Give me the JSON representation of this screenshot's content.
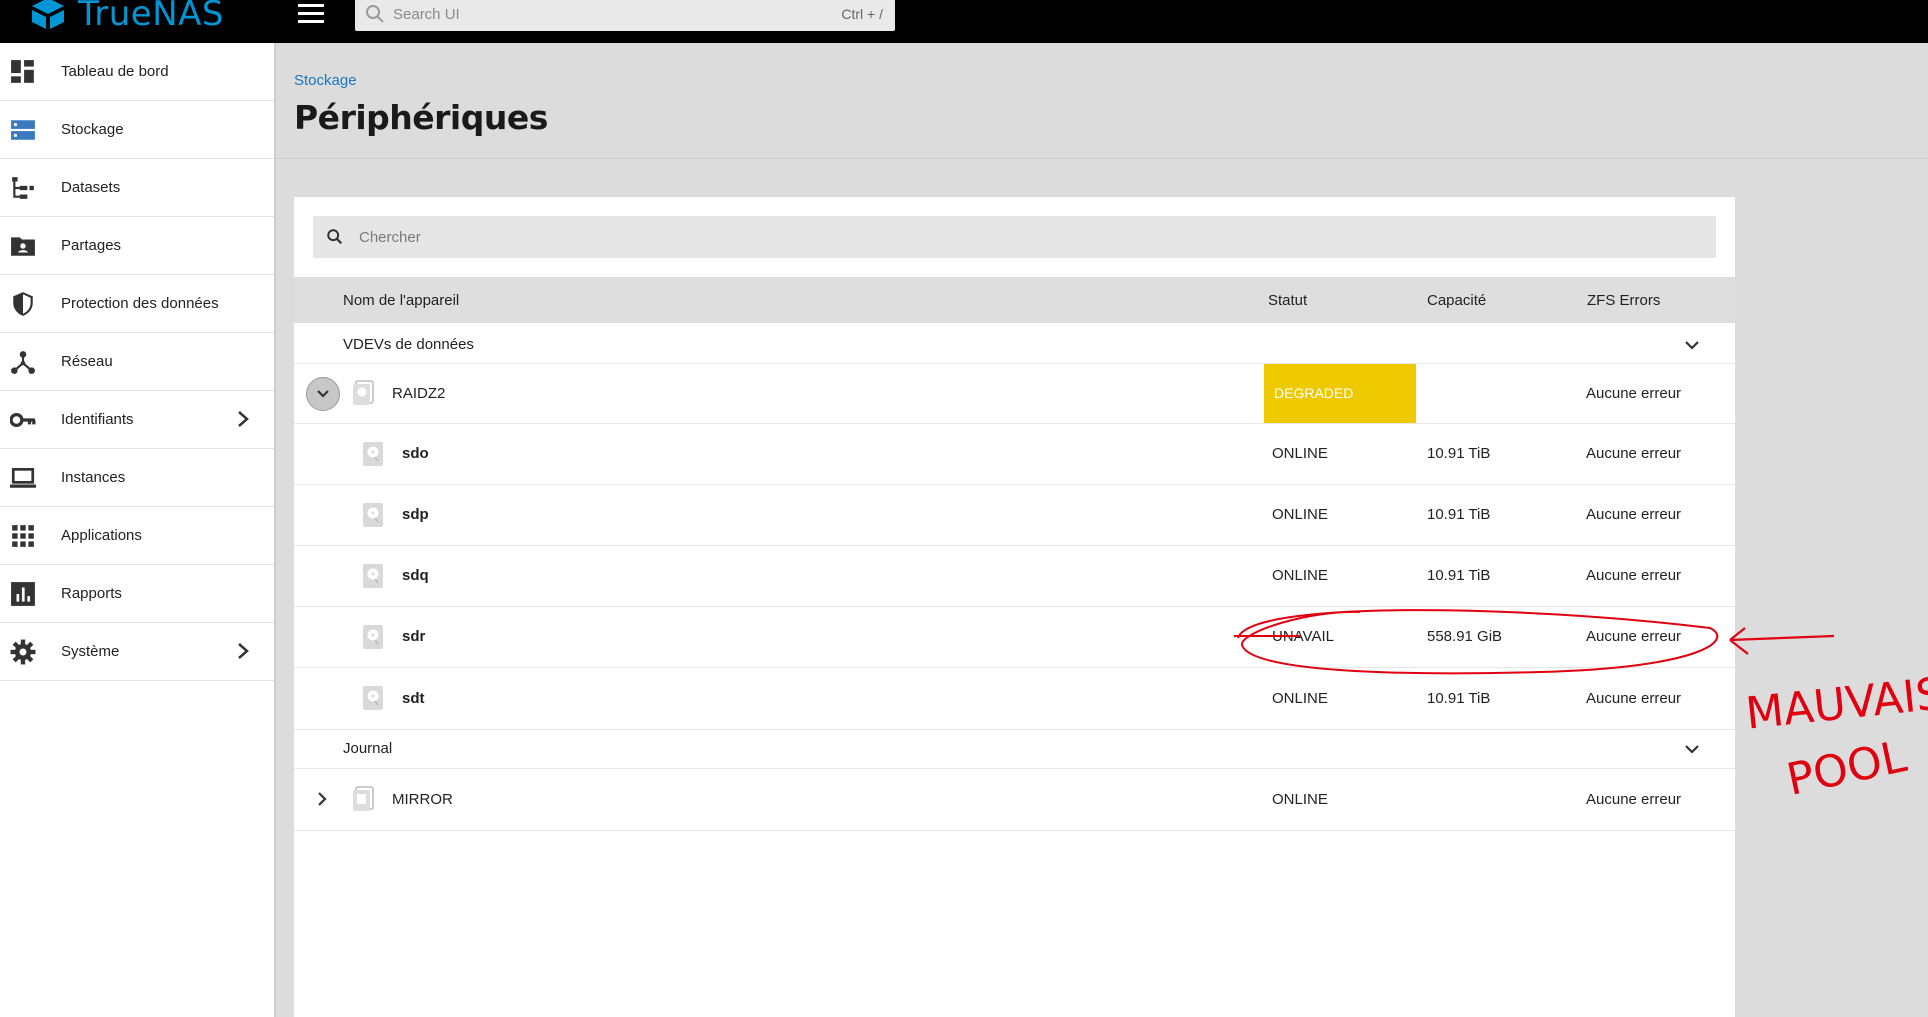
{
  "app": {
    "name": "TrueNAS"
  },
  "search": {
    "placeholder": "Search UI",
    "shortcut": "Ctrl + /"
  },
  "sidebar": {
    "items": [
      {
        "label": "Tableau de bord",
        "icon": "dashboard-icon"
      },
      {
        "label": "Stockage",
        "icon": "storage-icon"
      },
      {
        "label": "Datasets",
        "icon": "datasets-icon"
      },
      {
        "label": "Partages",
        "icon": "shares-icon"
      },
      {
        "label": "Protection des données",
        "icon": "shield-icon"
      },
      {
        "label": "Réseau",
        "icon": "network-icon"
      },
      {
        "label": "Identifiants",
        "icon": "key-icon"
      },
      {
        "label": "Instances",
        "icon": "laptop-icon"
      },
      {
        "label": "Applications",
        "icon": "apps-grid-icon"
      },
      {
        "label": "Rapports",
        "icon": "reports-icon"
      },
      {
        "label": "Système",
        "icon": "gear-icon"
      }
    ]
  },
  "breadcrumb": "Stockage",
  "page_title": "Périphériques",
  "table": {
    "search_placeholder": "Chercher",
    "headers": {
      "name": "Nom de l'appareil",
      "status": "Statut",
      "capacity": "Capacité",
      "errors": "ZFS Errors"
    },
    "sections": {
      "data": "VDEVs de données",
      "log": "Journal"
    },
    "raidz2": {
      "name": "RAIDZ2",
      "status": "DEGRADED",
      "errors": "Aucune erreur"
    },
    "disks": [
      {
        "name": "sdo",
        "status": "ONLINE",
        "capacity": "10.91 TiB",
        "errors": "Aucune erreur"
      },
      {
        "name": "sdp",
        "status": "ONLINE",
        "capacity": "10.91 TiB",
        "errors": "Aucune erreur"
      },
      {
        "name": "sdq",
        "status": "ONLINE",
        "capacity": "10.91 TiB",
        "errors": "Aucune erreur"
      },
      {
        "name": "sdr",
        "status": "UNAVAIL",
        "capacity": "558.91 GiB",
        "errors": "Aucune erreur"
      },
      {
        "name": "sdt",
        "status": "ONLINE",
        "capacity": "10.91 TiB",
        "errors": "Aucune erreur"
      }
    ],
    "mirror": {
      "name": "MIRROR",
      "status": "ONLINE",
      "errors": "Aucune erreur"
    }
  },
  "annotation": {
    "line1": "MAUVAIS",
    "line2": "POOL"
  },
  "colors": {
    "accent": "#0095d5",
    "degraded": "#efc900",
    "annotation": "#e0000f"
  }
}
